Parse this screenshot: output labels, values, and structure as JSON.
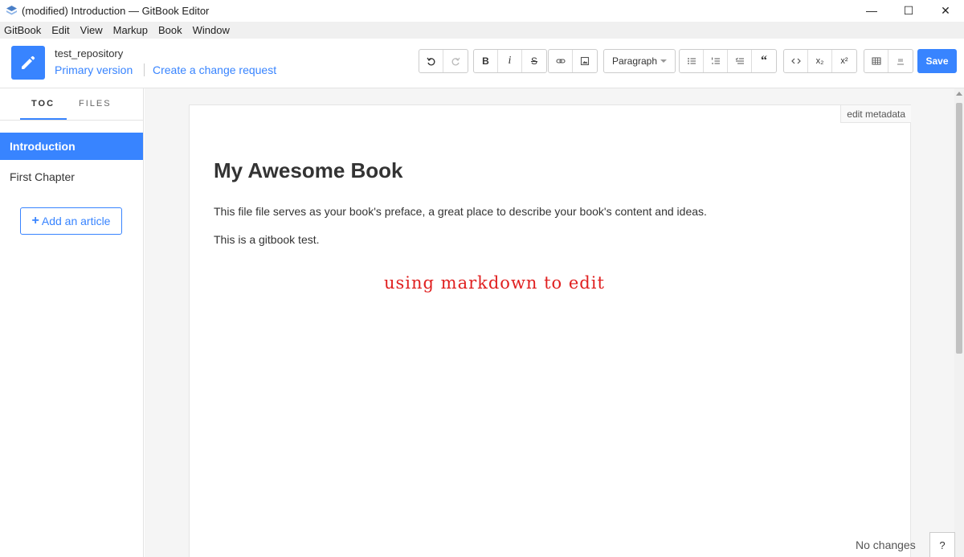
{
  "window": {
    "title": "(modified) Introduction — GitBook Editor",
    "minimize": "—",
    "maximize": "☐",
    "close": "✕"
  },
  "menu": [
    "GitBook",
    "Edit",
    "View",
    "Markup",
    "Book",
    "Window"
  ],
  "header": {
    "repo_name": "test_repository",
    "version_link": "Primary version",
    "change_link": "Create a change request"
  },
  "toolbar": {
    "bold": "B",
    "italic": "i",
    "strike": "S",
    "paragraph": "Paragraph",
    "subscript": "x₂",
    "superscript": "x²",
    "save": "Save"
  },
  "sidebar": {
    "tab_toc": "TOC",
    "tab_files": "FILES",
    "items": [
      {
        "label": "Introduction",
        "active": true
      },
      {
        "label": "First Chapter",
        "active": false
      }
    ],
    "add_article": "Add an article"
  },
  "editor": {
    "edit_metadata": "edit metadata",
    "title": "My Awesome Book",
    "paragraph1": "This file file serves as your book's preface, a great place to describe your book's content and ideas.",
    "paragraph2": "This is a gitbook test.",
    "annotation": "using markdown to edit"
  },
  "status": {
    "changes": "No changes",
    "help": "?"
  },
  "colors": {
    "accent": "#3884ff",
    "annotation": "#e02020"
  }
}
